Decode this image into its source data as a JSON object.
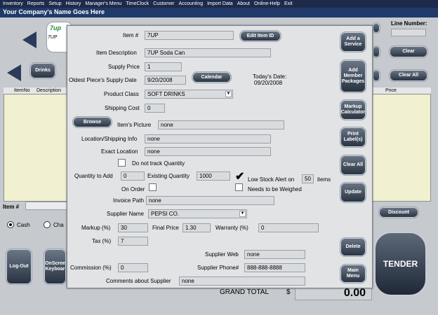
{
  "menu": [
    "Inventory",
    "Reports",
    "Setup",
    "History",
    "Manager's Menu",
    "TimeClock",
    "Customer",
    "Accounting",
    "Import Data",
    "About",
    "Online-Help",
    "Exit"
  ],
  "company_name": "Your Company's Name Goes Here",
  "background": {
    "line_number_label": "Line Number:",
    "clear_label": "Clear",
    "clear_all_label": "Clear All",
    "drinks_label": "Drinks",
    "logo_text": "7up",
    "logo_label": "7UP",
    "columns": [
      "ItemNo",
      "Description",
      "Price"
    ],
    "item_label": "Item #",
    "cash_label": "Cash",
    "charge_label": "Cha",
    "discount_label": "Discount",
    "logout_label": "Log-Out",
    "keyboard_label": "OnScree Keyboar",
    "tender_label": "TENDER",
    "grand_total_label": "GRAND TOTAL",
    "currency_symbol": "$",
    "grand_total_value": "0.00"
  },
  "dialog": {
    "item_no_label": "Item #",
    "item_no": "7UP",
    "edit_item_id": "Edit Item ID",
    "item_desc_label": "Item Description",
    "item_desc": "7UP Soda Can",
    "supply_price_label": "Supply Price",
    "supply_price": "1",
    "oldest_supply_date_label": "Oldest Piece's Supply Date",
    "oldest_supply_date": "9/20/2008",
    "calendar_label": "Calendar",
    "todays_date_label": "Today's Date:",
    "todays_date": "09/20/2008",
    "product_class_label": "Product Class",
    "product_class": "SOFT DRINKS",
    "shipping_cost_label": "Shipping Cost",
    "shipping_cost": "0",
    "browse_label": "Browse",
    "picture_label": "Item's Picture",
    "picture": "none",
    "location_label": "Location/Shipping Info",
    "location": "none",
    "exact_location_label": "Exact Location",
    "exact_location": "none",
    "no_track_label": "Do not track Quantity",
    "qty_to_add_label": "Quantity to Add",
    "qty_to_add": "0",
    "existing_qty_label": "Existing Quantity",
    "existing_qty": "1000",
    "low_stock_label": "Low Stock Alert on",
    "low_stock_value": "50",
    "items_label": "items",
    "on_order_label": "On Order",
    "needs_weighed_label": "Needs to be Weighed",
    "invoice_path_label": "Invoice Path",
    "invoice_path": "none",
    "supplier_name_label": "Supplier Name",
    "supplier_name": "PEPSI CO.",
    "markup_label": "Markup (%)",
    "markup": "30",
    "final_price_label": "Final Price",
    "final_price": "1.30",
    "warranty_label": "Warranty (%)",
    "warranty": "0",
    "tax_label": "Tax (%)",
    "tax": "7",
    "supplier_web_label": "Supplier Web",
    "supplier_web": "none",
    "commission_label": "Commission (%)",
    "commission": "0",
    "supplier_phone_label": "Supplier Phone#",
    "supplier_phone": "888-888-8888",
    "comments_label": "Comments about Supplier",
    "comments": "none",
    "side_buttons": {
      "add_service": "Add a Service",
      "add_member": "Add Member Packages",
      "markup_calc": "Markup Calculator",
      "print_labels": "Print Label(s)",
      "clear_all": "Clear All",
      "update": "Update",
      "delete": "Delete",
      "main_menu": "Main Menu"
    }
  },
  "colors": {
    "menubar": "#1e2a4a",
    "header": "#203a69",
    "button_dark": "#27313f",
    "table_bg": "#f1f0d0"
  }
}
